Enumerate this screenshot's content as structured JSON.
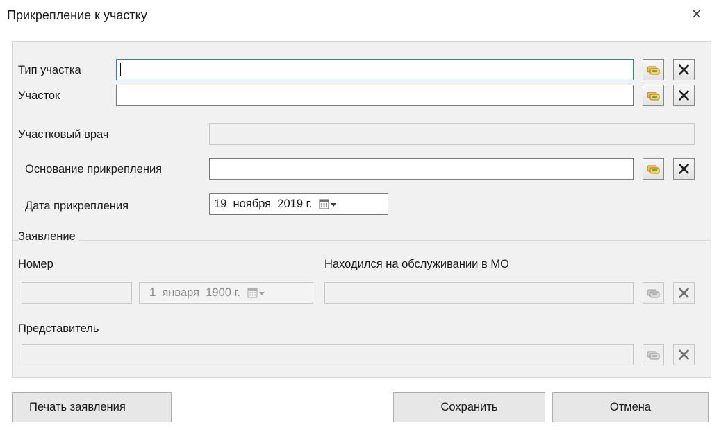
{
  "dialog": {
    "title": "Прикрепление к участку",
    "close_glyph": "×"
  },
  "form": {
    "site_type": {
      "label": "Тип участка",
      "value": ""
    },
    "site": {
      "label": "Участок",
      "value": ""
    },
    "doctor": {
      "label": "Участковый врач",
      "value": ""
    },
    "basis": {
      "label": "Основание прикрепления",
      "value": ""
    },
    "attach_date": {
      "label": "Дата прикрепления",
      "value": "19  ноября  2019 г."
    }
  },
  "statement": {
    "group_label": "Заявление",
    "number": {
      "label": "Номер",
      "value": ""
    },
    "number_date": {
      "value": "1  января  1900 г."
    },
    "previous_mo": {
      "label": "Находился на обслуживании в МО",
      "value": ""
    },
    "representative": {
      "label": "Представитель",
      "value": ""
    }
  },
  "buttons": {
    "print": "Печать заявления",
    "save": "Сохранить",
    "cancel": "Отмена"
  },
  "icons": {
    "lookup": "lookup-icon",
    "clear": "clear-icon",
    "calendar": "calendar-dropdown-icon"
  }
}
